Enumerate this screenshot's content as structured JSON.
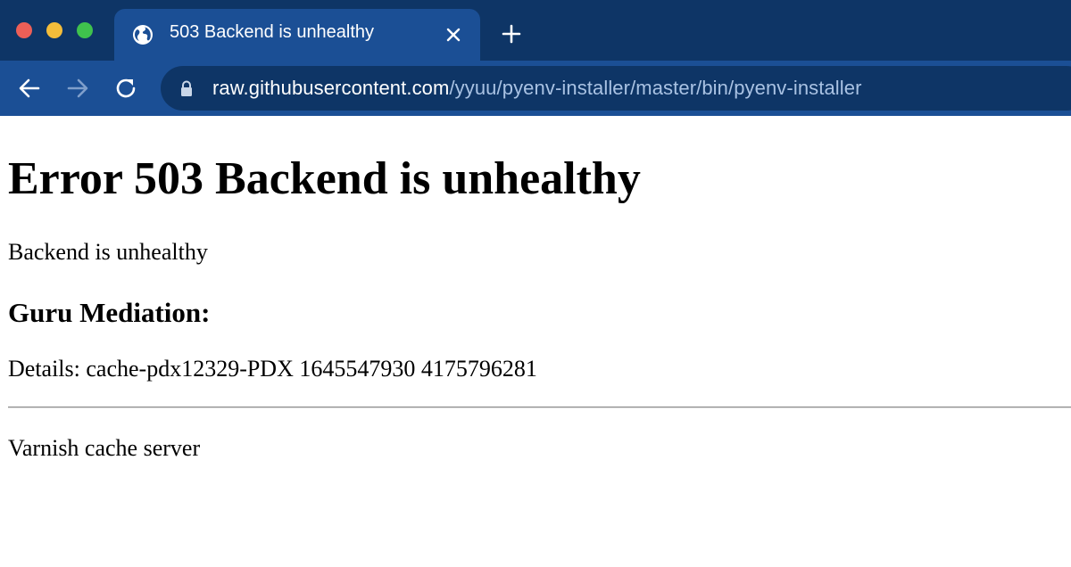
{
  "window": {
    "traffic_lights": [
      "close",
      "minimize",
      "maximize"
    ]
  },
  "tab": {
    "title": "503 Backend is unhealthy",
    "icon": "globe-icon",
    "close_icon": "close-icon"
  },
  "new_tab_icon": "plus-icon",
  "toolbar": {
    "back_icon": "arrow-left-icon",
    "forward_icon": "arrow-right-icon",
    "reload_icon": "reload-icon",
    "lock_icon": "lock-icon",
    "url_host": "raw.githubusercontent.com",
    "url_path": "/yyuu/pyenv-installer/master/bin/pyenv-installer"
  },
  "page": {
    "heading": "Error 503 Backend is unhealthy",
    "message": "Backend is unhealthy",
    "subheading": "Guru Mediation:",
    "details": "Details: cache-pdx12329-PDX 1645547930 4175796281",
    "footer": "Varnish cache server"
  },
  "colors": {
    "titlebar": "#0e3566",
    "active_tab": "#1b4f95",
    "toolbar": "#1b4f95",
    "omnibox": "#0e3566",
    "url_path": "#a9c2e3",
    "close_light": "#ed5f57",
    "minimize_light": "#f4bd3a",
    "maximize_light": "#3fc24d"
  }
}
